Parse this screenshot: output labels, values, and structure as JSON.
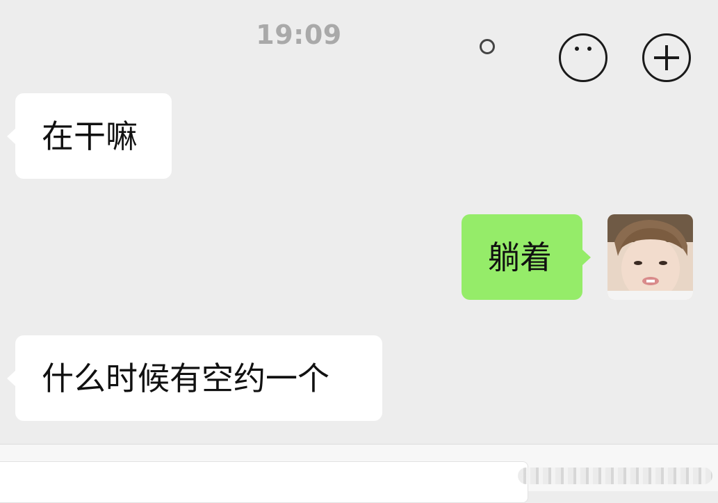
{
  "conversation": {
    "timestamp": "19:09",
    "messages": [
      {
        "direction": "incoming",
        "text": "在干嘛"
      },
      {
        "direction": "outgoing",
        "text": "躺着"
      },
      {
        "direction": "incoming",
        "text": "什么时候有空约一个"
      }
    ],
    "avatar": {
      "description_icon": "user-avatar-photo"
    }
  },
  "input_bar": {
    "icons": [
      "voice-icon",
      "emoji-icon",
      "plus-icon"
    ]
  },
  "colors": {
    "background": "#ededed",
    "incoming_bubble": "#ffffff",
    "outgoing_bubble": "#95ec69",
    "timestamp": "#a9a9a9"
  }
}
